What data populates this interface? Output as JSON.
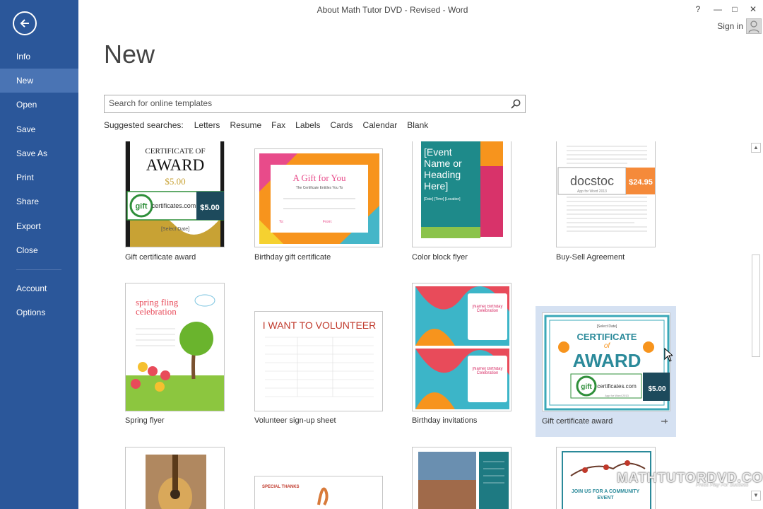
{
  "window": {
    "title": "About Math Tutor DVD - Revised - Word",
    "help": "?",
    "minimize": "—",
    "maximize": "□",
    "close": "✕",
    "sign_in": "Sign in"
  },
  "sidebar": {
    "items": [
      {
        "label": "Info"
      },
      {
        "label": "New",
        "active": true
      },
      {
        "label": "Open"
      },
      {
        "label": "Save"
      },
      {
        "label": "Save As"
      },
      {
        "label": "Print"
      },
      {
        "label": "Share"
      },
      {
        "label": "Export"
      },
      {
        "label": "Close"
      },
      {
        "label": "Account"
      },
      {
        "label": "Options"
      }
    ]
  },
  "page": {
    "title": "New"
  },
  "search": {
    "placeholder": "Search for online templates",
    "suggested_label": "Suggested searches:",
    "suggestions": [
      "Letters",
      "Resume",
      "Fax",
      "Labels",
      "Cards",
      "Calendar",
      "Blank"
    ]
  },
  "templates": [
    {
      "label": "Gift certificate award",
      "thumb_text": {
        "line1": "CERTIFICATE OF",
        "line2": "AWARD",
        "price": "$5.00",
        "badge_price": "$5.00",
        "badge": "certificates.com",
        "logo": "gift",
        "date": "[Select Date]"
      }
    },
    {
      "label": "Birthday gift certificate",
      "thumb_text": {
        "title": "A Gift for You",
        "sub": "The Certificate Entitles You To",
        "to": "To:",
        "from": "From:"
      }
    },
    {
      "label": "Color block flyer",
      "thumb_text": {
        "heading": "[Event Name or Heading Here]",
        "details": "[Date] [Time] [Location]"
      }
    },
    {
      "label": "Buy-Sell Agreement",
      "thumb_text": {
        "brand": "docstoc",
        "price": "$24.95",
        "sub": "App for Word 2013"
      }
    },
    {
      "label": "Spring flyer",
      "thumb_text": {
        "title": "spring fling celebration"
      }
    },
    {
      "label": "Volunteer sign-up sheet",
      "thumb_text": {
        "title": "I WANT TO VOLUNTEER"
      }
    },
    {
      "label": "Birthday invitations",
      "thumb_text": {
        "name": "[Name] Birthday Celebration"
      }
    },
    {
      "label": "Gift certificate award",
      "thumb_text": {
        "date": "[Select Date]",
        "line1": "CERTIFICATE",
        "line2": "of",
        "line3": "AWARD",
        "price": "$5.00",
        "badge": "certificates.com",
        "logo": "gift",
        "sub": "App for Word 2013"
      }
    },
    {
      "label": "",
      "thumb_text": {}
    },
    {
      "label": "",
      "thumb_text": {
        "title": "SPECIAL THANKS"
      }
    },
    {
      "label": "",
      "thumb_text": {}
    },
    {
      "label": "",
      "thumb_text": {
        "title": "JOIN US FOR A COMMUNITY EVENT"
      }
    }
  ],
  "watermark": {
    "text": "MATHTUTORDVD.COM",
    "sub": "Press Play For Success"
  },
  "colors": {
    "sidebar": "#2b579a",
    "sidebar_active": "#4a74b4",
    "selected_tile": "#d5e1f2"
  }
}
